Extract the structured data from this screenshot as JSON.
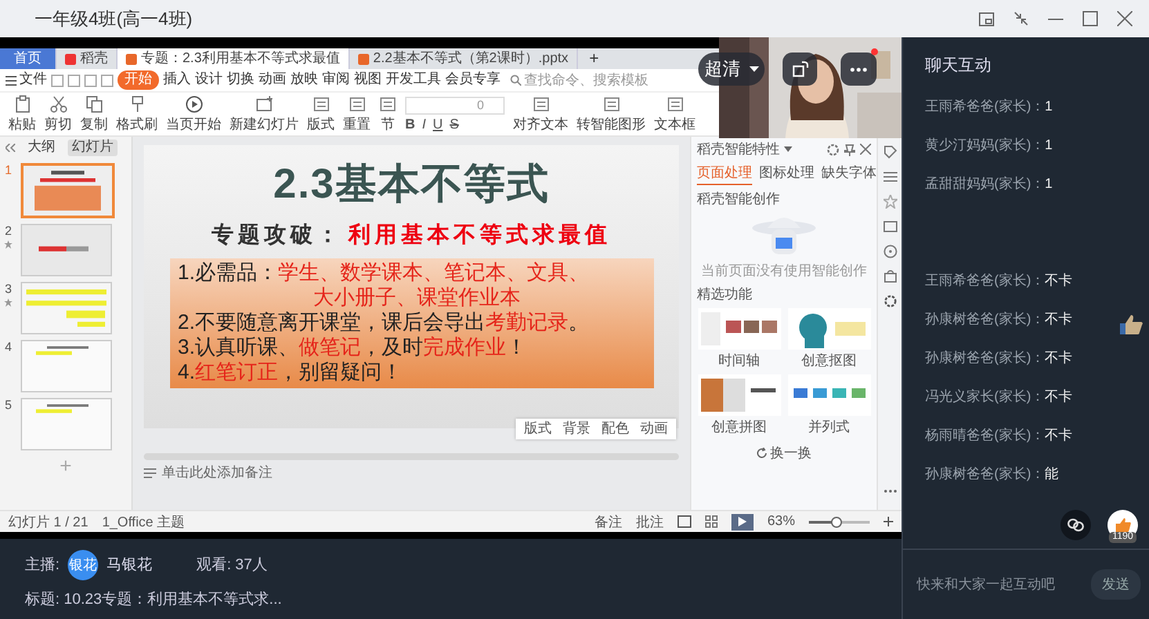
{
  "window": {
    "title": "一年级4班(高一4班)"
  },
  "share": {
    "tabs": [
      {
        "label": "首页",
        "kind": "home",
        "selected": false
      },
      {
        "label": "稻壳",
        "kind": "app",
        "selected": false
      },
      {
        "label": "专题：2.3利用基本不等式求最值",
        "kind": "doc",
        "selected": true
      },
      {
        "label": "2.2基本不等式（第2课时）.pptx",
        "kind": "doc",
        "selected": false
      }
    ],
    "add_tab": "+",
    "file_menu": "文件",
    "menu": [
      {
        "label": "开始",
        "selected": true
      },
      {
        "label": "插入",
        "selected": false
      },
      {
        "label": "设计",
        "selected": false
      },
      {
        "label": "切换",
        "selected": false
      },
      {
        "label": "动画",
        "selected": false
      },
      {
        "label": "放映",
        "selected": false
      },
      {
        "label": "审阅",
        "selected": false
      },
      {
        "label": "视图",
        "selected": false
      },
      {
        "label": "开发工具",
        "selected": false
      },
      {
        "label": "会员专享",
        "selected": false
      }
    ],
    "search": {
      "placeholder": "查找命令、搜索模板"
    },
    "ribbon": [
      {
        "label": "粘贴",
        "kind": "paste"
      },
      {
        "label": "剪切",
        "kind": "cut"
      },
      {
        "label": "复制",
        "kind": "copy"
      },
      {
        "label": "格式刷",
        "kind": "brush"
      },
      {
        "label": "当页开始",
        "kind": "play"
      },
      {
        "label": "新建幻灯片",
        "kind": "new-slide"
      },
      {
        "label": "版式",
        "kind": "panel"
      },
      {
        "label": "重置",
        "kind": "panel"
      },
      {
        "label": "节",
        "kind": "panel"
      }
    ],
    "font_size": "0",
    "format_buttons": [
      "B",
      "I",
      "U",
      "S"
    ],
    "ribbon_right": [
      {
        "label": "对齐文本",
        "kind": "panel"
      },
      {
        "label": "转智能图形",
        "kind": "panel"
      },
      {
        "label": "文本框",
        "kind": "panel"
      }
    ],
    "panel_tabs": [
      {
        "label": "大纲",
        "selected": false
      },
      {
        "label": "幻灯片",
        "selected": true
      }
    ],
    "thumbnails": [
      {
        "number": "1",
        "kind": "title",
        "selected": true,
        "animated": false
      },
      {
        "number": "2",
        "kind": "red",
        "selected": false,
        "animated": true
      },
      {
        "number": "3",
        "kind": "yellow",
        "selected": false,
        "animated": true
      },
      {
        "number": "4",
        "kind": "plain",
        "selected": false,
        "animated": false
      },
      {
        "number": "5",
        "kind": "plain",
        "selected": false,
        "animated": false
      }
    ],
    "add_slide": "+",
    "slide": {
      "title": "2.3基本不等式",
      "subtitle_lead": "专题攻破：",
      "subtitle": "利用基本不等式求最值",
      "lines": [
        {
          "indent": false,
          "segments": [
            {
              "text": "1.必需品：",
              "red": false
            },
            {
              "text": "学生、数学课本、笔记本、文具、",
              "red": true
            }
          ]
        },
        {
          "indent": true,
          "segments": [
            {
              "text": "大小册子、课堂作业本",
              "red": true
            }
          ]
        },
        {
          "indent": false,
          "segments": [
            {
              "text": "2.不要随意离开课堂，课后会导出",
              "red": false
            },
            {
              "text": "考勤记录",
              "red": true
            },
            {
              "text": "。",
              "red": false
            }
          ]
        },
        {
          "indent": false,
          "segments": [
            {
              "text": "3.认真听课、",
              "red": false
            },
            {
              "text": "做笔记",
              "red": true
            },
            {
              "text": "，及时",
              "red": false
            },
            {
              "text": "完成作业",
              "red": true
            },
            {
              "text": "！",
              "red": false
            }
          ]
        },
        {
          "indent": false,
          "segments": [
            {
              "text": "4.",
              "red": false
            },
            {
              "text": "红笔订正",
              "red": true
            },
            {
              "text": "，别留疑问！",
              "red": false
            }
          ]
        }
      ]
    },
    "slide_tools": [
      "版式",
      "背景",
      "配色",
      "动画"
    ],
    "notes": "单击此处添加备注",
    "status": {
      "slide": "幻灯片 1 / 21",
      "theme": "1_Office 主题",
      "notes": "备注",
      "comment": "批注",
      "zoom": "63%",
      "level": 0.45
    },
    "assistant": {
      "title": "稻壳智能特性",
      "tabs": [
        {
          "label": "页面处理",
          "selected": true
        },
        {
          "label": "图标处理",
          "selected": false
        },
        {
          "label": "缺失字体",
          "selected": false
        }
      ],
      "heading": "稻壳智能创作",
      "empty": "当前页面没有使用智能创作",
      "section": "精选功能",
      "cards": [
        {
          "label": "时间轴",
          "kind": "timeline"
        },
        {
          "label": "创意抠图",
          "kind": "cutout"
        },
        {
          "label": "创意拼图",
          "kind": "collage"
        },
        {
          "label": "并列式",
          "kind": "columns"
        }
      ],
      "refresh": "换一换"
    }
  },
  "video": {
    "kind": "picture",
    "quality": "超清"
  },
  "info": {
    "host_label": "主播:",
    "avatar": "银花",
    "host": "马银花",
    "viewers": "观看: 37人",
    "title": "标题: 10.23专题：利用基本不等式求..."
  },
  "chat": {
    "title": "聊天互动",
    "messages": [
      {
        "name": "王雨希爸爸(家长)：",
        "text": "1"
      },
      {
        "name": "黄少汀妈妈(家长)：",
        "text": "1"
      },
      {
        "name": "孟甜甜妈妈(家长)：",
        "text": "1"
      }
    ],
    "later_messages": [
      {
        "name": "王雨希爸爸(家长)：",
        "text": "不卡"
      },
      {
        "name": "孙康树爸爸(家长)：",
        "text": "不卡"
      },
      {
        "name": "孙康树爸爸(家长)：",
        "text": "不卡"
      },
      {
        "name": "冯光义家长(家长)：",
        "text": "不卡"
      },
      {
        "name": "杨雨晴爸爸(家长)：",
        "text": "不卡"
      },
      {
        "name": "孙康树爸爸(家长)：",
        "text": "能"
      }
    ],
    "likes": "1190",
    "input": {
      "placeholder": "快来和大家一起互动吧"
    },
    "send": "发送"
  }
}
